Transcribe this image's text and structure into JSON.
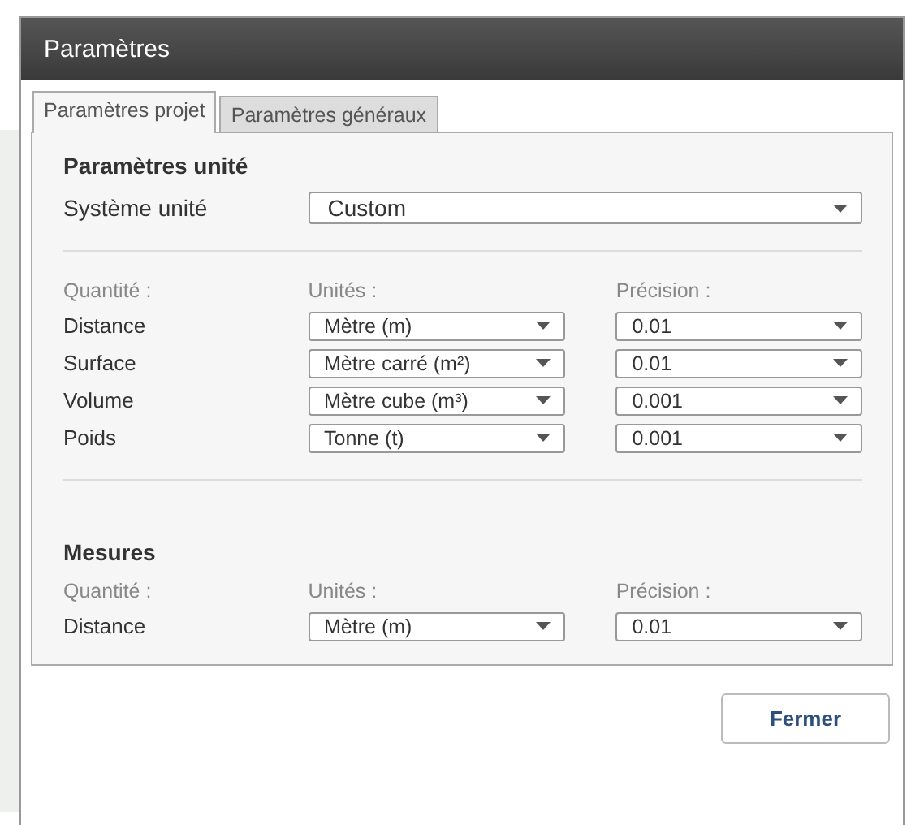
{
  "window": {
    "title": "Paramètres"
  },
  "tabs": [
    {
      "label": "Paramètres projet",
      "selected": true
    },
    {
      "label": "Paramètres généraux",
      "selected": false
    }
  ],
  "sections": [
    {
      "title": "Paramètres unité",
      "system": {
        "label": "Système unité",
        "value": "Custom"
      },
      "columns": [
        "Quantité :",
        "Unités :",
        "Précision :"
      ],
      "rows": [
        {
          "quantity": "Distance",
          "unit": "Mètre (m)",
          "precision": "0.01"
        },
        {
          "quantity": "Surface",
          "unit": "Mètre carré (m²)",
          "precision": "0.01"
        },
        {
          "quantity": "Volume",
          "unit": "Mètre cube (m³)",
          "precision": "0.001"
        },
        {
          "quantity": "Poids",
          "unit": "Tonne (t)",
          "precision": "0.001"
        }
      ]
    },
    {
      "title": "Mesures",
      "columns": [
        "Quantité :",
        "Unités :",
        "Précision :"
      ],
      "rows": [
        {
          "quantity": "Distance",
          "unit": "Mètre (m)",
          "precision": "0.01"
        }
      ]
    }
  ],
  "buttons": [
    "Fermer"
  ]
}
